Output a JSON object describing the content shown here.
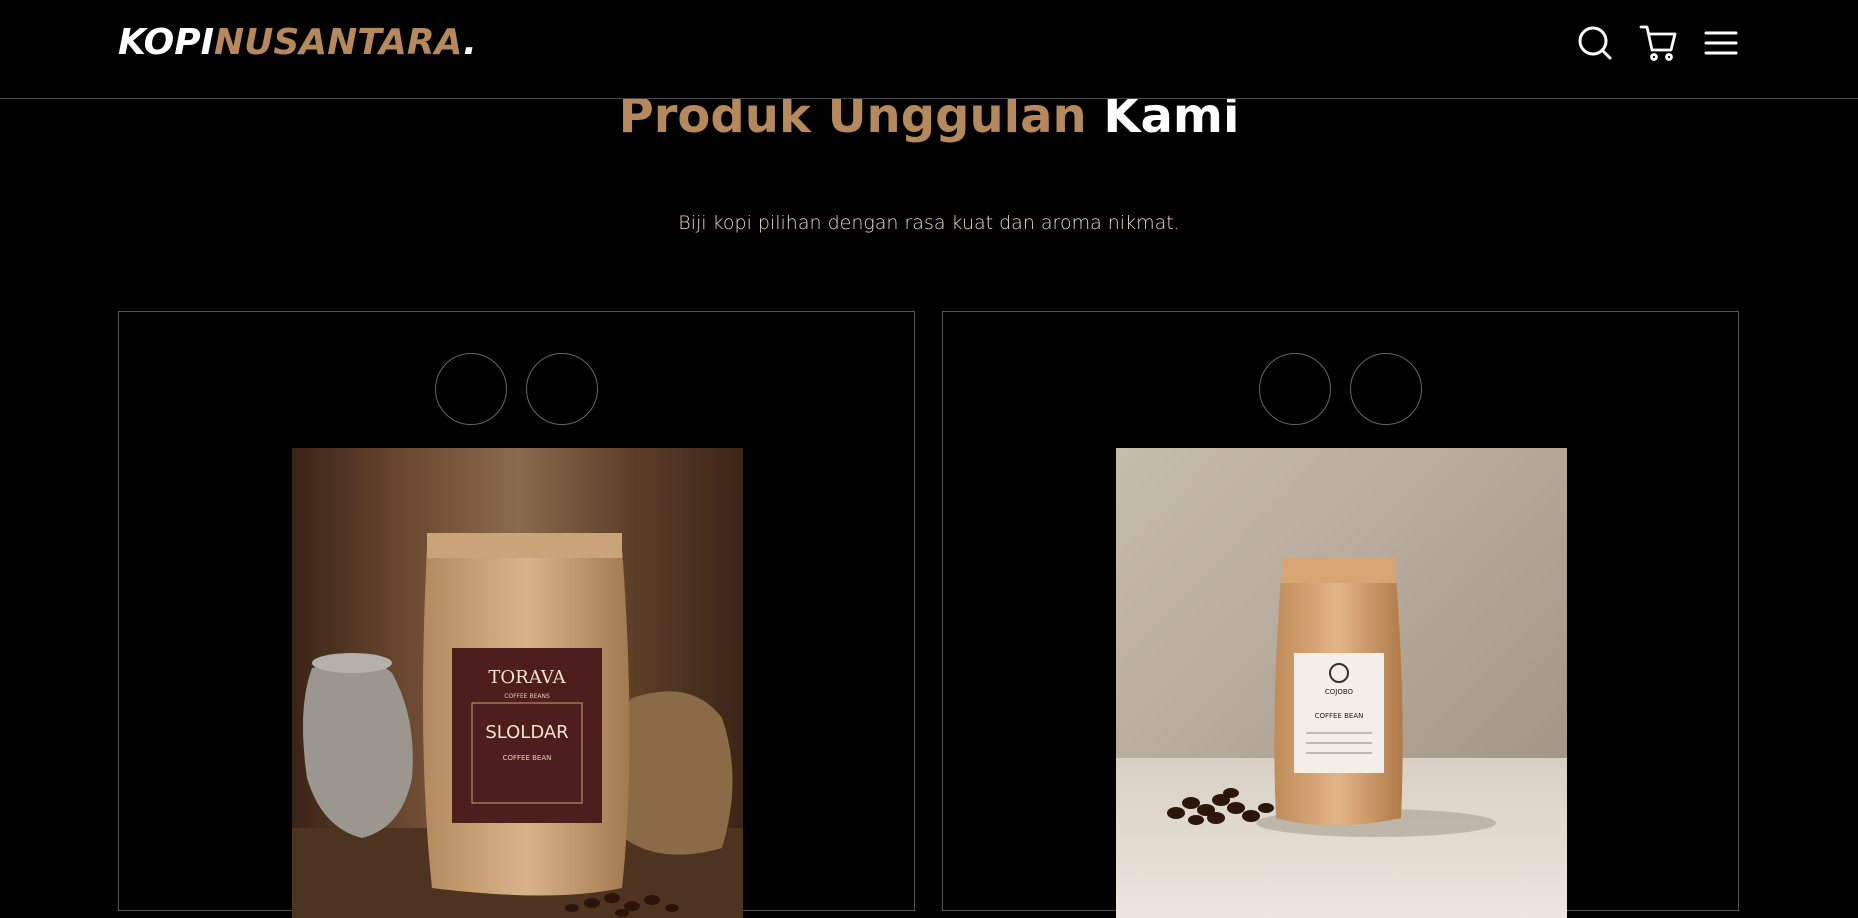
{
  "navbar": {
    "logo_part1": "KOPI",
    "logo_part2": "NUSANTARA",
    "logo_dot": ".",
    "icons": [
      "search-icon",
      "cart-icon",
      "menu-icon"
    ]
  },
  "section": {
    "title_part1": "Produk Unggulan",
    "title_part2": "Kami",
    "subtitle": "Biji kopi pilihan dengan rasa kuat dan aroma nikmat."
  },
  "products": [
    {
      "label_brand": "TORAVA",
      "label_sub": "COFFEE BEANS",
      "label_main": "SLOLDAR",
      "label_type": "COFFEE BEAN"
    },
    {
      "label_brand": "COJOBO",
      "label_main": "COFFEE BEAN"
    }
  ],
  "colors": {
    "accent": "#b6895b",
    "background": "#010101",
    "text": "#ffffff",
    "subtitle": "#e9d9c6"
  }
}
